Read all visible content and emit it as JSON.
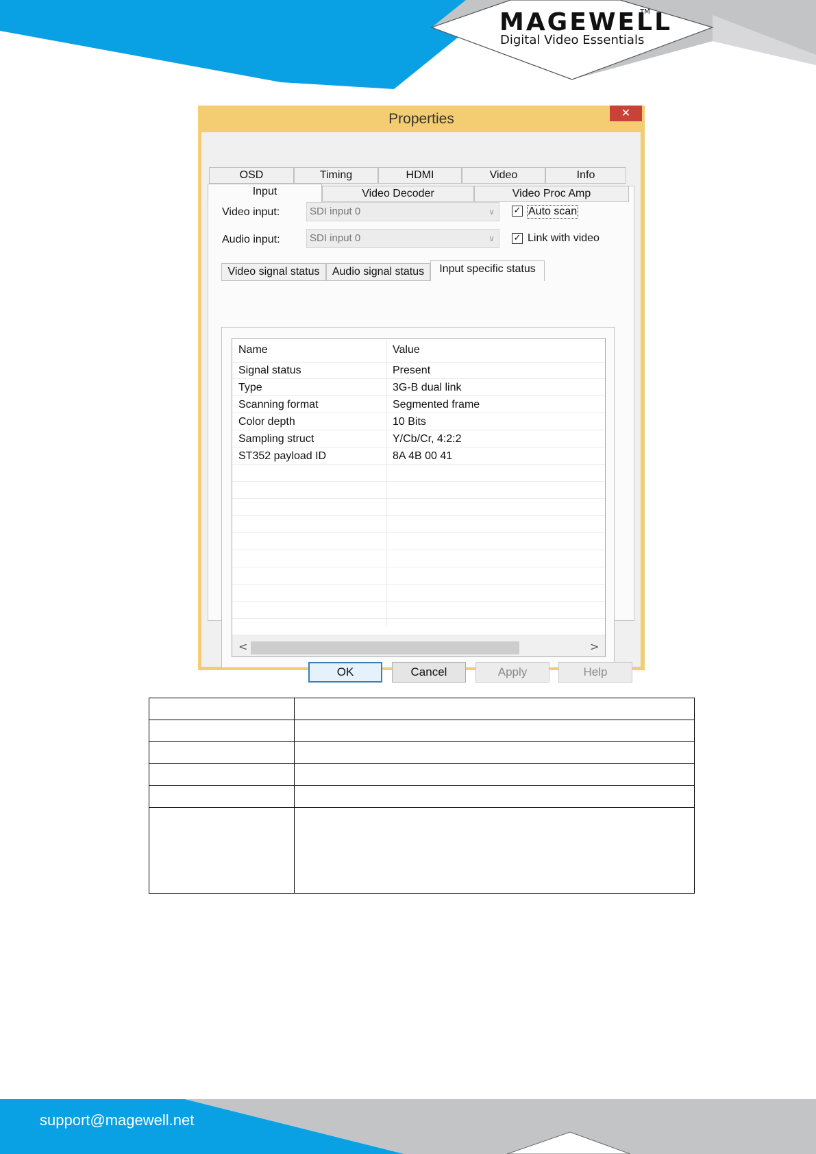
{
  "header": {
    "brand": "MAGEWELL",
    "trademark": "TM",
    "tagline": "Digital Video Essentials",
    "colors": {
      "blue": "#0aa0e4",
      "gray": "#c3c4c6"
    }
  },
  "dialog": {
    "title": "Properties",
    "close_symbol": "✕",
    "tabs_row1": [
      "OSD",
      "Timing",
      "HDMI",
      "Video",
      "Info"
    ],
    "tabs_row2": [
      "Input",
      "Video Decoder",
      "Video Proc Amp"
    ],
    "active_tab": "Input",
    "video_input": {
      "label": "Video input:",
      "value": "SDI input 0"
    },
    "audio_input": {
      "label": "Audio input:",
      "value": "SDI input 0"
    },
    "auto_scan": {
      "label": "Auto scan",
      "checked": true
    },
    "link_with_video": {
      "label": "Link with video",
      "checked": true
    },
    "subtabs": [
      "Video signal status",
      "Audio signal status",
      "Input specific status"
    ],
    "active_subtab": "Input specific status",
    "list": {
      "columns": [
        "Name",
        "Value"
      ],
      "rows": [
        [
          "Signal status",
          "Present"
        ],
        [
          "Type",
          "3G-B dual link"
        ],
        [
          "Scanning format",
          "Segmented frame"
        ],
        [
          "Color depth",
          "10 Bits"
        ],
        [
          "Sampling struct",
          "Y/Cb/Cr, 4:2:2"
        ],
        [
          "ST352 payload ID",
          "8A 4B 00 41"
        ]
      ]
    },
    "scroll_left": "<",
    "scroll_right": ">",
    "buttons": {
      "ok": "OK",
      "cancel": "Cancel",
      "apply": "Apply",
      "help": "Help"
    }
  },
  "footer": {
    "email": "support@magewell.net",
    "colors": {
      "blue": "#0aa0e4",
      "gray": "#c3c4c6"
    }
  }
}
